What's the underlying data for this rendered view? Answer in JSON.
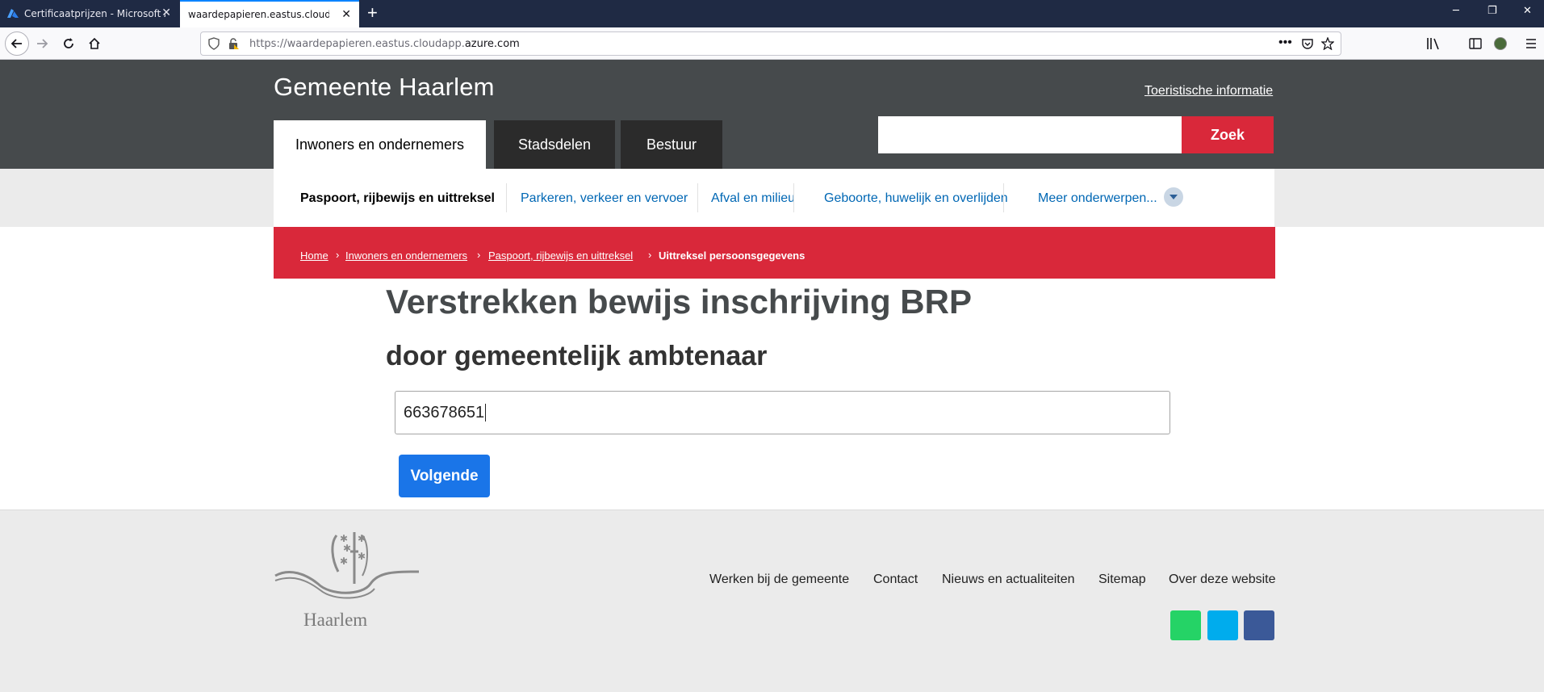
{
  "browser": {
    "tabs": [
      {
        "title": "Certificaatprijzen - Microsoft Azure",
        "active": false,
        "favicon": "azure-icon"
      },
      {
        "title": "waardepapieren.eastus.cloudapp.azure.com",
        "active": true,
        "favicon": "none"
      }
    ],
    "url_prefix": "https://waardepapieren.eastus.cloudapp.",
    "url_domain": "azure.com"
  },
  "header": {
    "logo": "Gemeente Haarlem",
    "tourist_link": "Toeristische informatie",
    "tabs": [
      {
        "label": "Inwoners en ondernemers",
        "active": true
      },
      {
        "label": "Stadsdelen",
        "active": false
      },
      {
        "label": "Bestuur",
        "active": false
      }
    ],
    "search": {
      "value": "",
      "button": "Zoek"
    }
  },
  "subnav": {
    "items": [
      {
        "label": "Paspoort, rijbewijs en uittreksel",
        "current": true
      },
      {
        "label": "Parkeren, verkeer en vervoer",
        "current": false
      },
      {
        "label": "Afval en milieu",
        "current": false
      },
      {
        "label": "Geboorte, huwelijk en overlijden",
        "current": false
      },
      {
        "label": "Meer onderwerpen...",
        "current": false
      }
    ]
  },
  "breadcrumb": [
    {
      "label": "Home"
    },
    {
      "label": "Inwoners en ondernemers"
    },
    {
      "label": "Paspoort, rijbewijs en uittreksel"
    },
    {
      "label": "Uittreksel persoonsgegevens"
    }
  ],
  "main": {
    "title": "Verstrekken bewijs inschrijving BRP",
    "subtitle": "door gemeentelijk ambtenaar",
    "input_value": "663678651",
    "next_button": "Volgende"
  },
  "footer": {
    "logo_text": "Haarlem",
    "links": [
      "Werken bij de gemeente",
      "Contact",
      "Nieuws en actualiteiten",
      "Sitemap",
      "Over deze website"
    ],
    "social": [
      {
        "name": "whatsapp-icon",
        "color": "#25d366"
      },
      {
        "name": "twitter-icon",
        "color": "#00aced"
      },
      {
        "name": "facebook-icon",
        "color": "#3b5998"
      }
    ]
  },
  "colors": {
    "header_bg": "#464a4c",
    "accent_red": "#d9283a",
    "link_blue": "#0067b4",
    "button_blue": "#1a75e8"
  }
}
